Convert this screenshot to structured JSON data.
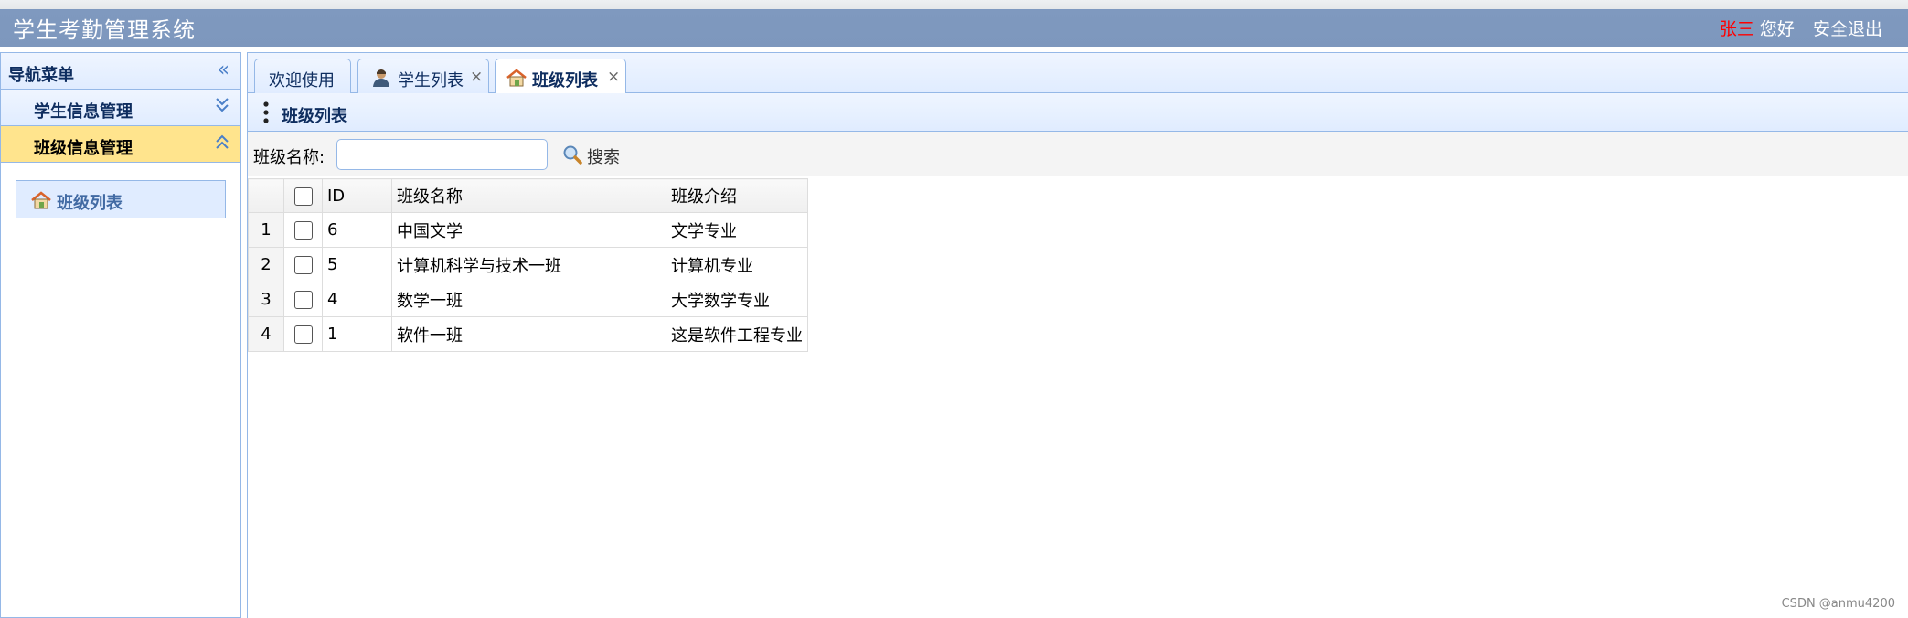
{
  "header": {
    "title": "学生考勤管理系统",
    "user_name": "张三",
    "greeting": "您好",
    "logout_label": "安全退出"
  },
  "sidebar": {
    "title": "导航菜单",
    "sections": [
      {
        "label": "学生信息管理",
        "expanded": false
      },
      {
        "label": "班级信息管理",
        "expanded": true
      }
    ],
    "items": [
      {
        "label": "班级列表",
        "icon": "house-icon"
      }
    ]
  },
  "tabs": [
    {
      "label": "欢迎使用",
      "icon": null,
      "closable": false,
      "selected": false
    },
    {
      "label": "学生列表",
      "icon": "user-icon",
      "closable": true,
      "selected": false
    },
    {
      "label": "班级列表",
      "icon": "house-icon",
      "closable": true,
      "selected": true
    }
  ],
  "tab_close_glyph": "×",
  "panel": {
    "title": "班级列表"
  },
  "search": {
    "label": "班级名称:",
    "value": "",
    "button_label": "搜索"
  },
  "table": {
    "columns": [
      "ID",
      "班级名称",
      "班级介绍"
    ],
    "rows": [
      {
        "num": "1",
        "id": "6",
        "name": "中国文学",
        "desc": "文学专业"
      },
      {
        "num": "2",
        "id": "5",
        "name": "计算机科学与技术一班",
        "desc": "计算机专业"
      },
      {
        "num": "3",
        "id": "4",
        "name": "数学一班",
        "desc": "大学数学专业"
      },
      {
        "num": "4",
        "id": "1",
        "name": "软件一班",
        "desc": "这是软件工程专业"
      }
    ]
  },
  "watermark": "CSDN @anmu4200",
  "colors": {
    "header_bg": "#7d97bd",
    "panel_border": "#95b8e7",
    "active_section": "#ffe48d",
    "user_name": "#ff0000"
  }
}
